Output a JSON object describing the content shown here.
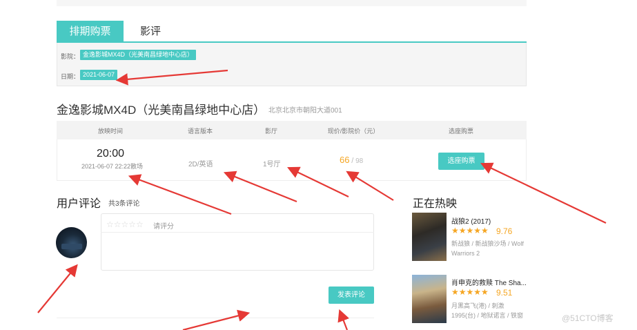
{
  "tabs": {
    "schedule": "排期购票",
    "reviews": "影评"
  },
  "filters": {
    "cinema_label": "影院：",
    "cinema_value": "金逸影城MX4D（光美南昌绿地中心店）",
    "date_label": "日期：",
    "date_value": "2021-06-07"
  },
  "cinema": {
    "name": "金逸影城MX4D（光美南昌绿地中心店）",
    "address": "北京北京市朝阳大道001"
  },
  "table": {
    "headers": [
      "放映时间",
      "语言版本",
      "影厅",
      "现价/影院价（元）",
      "选座购票"
    ],
    "rows": [
      {
        "start": "20:00",
        "end": "2021-06-07 22:22散场",
        "version": "2D/英语",
        "hall": "1号厅",
        "price": "66",
        "slash": "/",
        "original_price": "98",
        "button": "选座购票"
      }
    ]
  },
  "comments": {
    "title": "用户评论",
    "count": "共3条评论",
    "stars": "☆☆☆☆☆",
    "rate_hint": "请评分",
    "publish_button": "发表评论"
  },
  "hot": {
    "title": "正在热映",
    "movies": [
      {
        "title": "战狼2 (2017)",
        "stars": "★★★★★",
        "score": "9.76",
        "meta": "新战狼 / 新战狼沙场 / Wolf Warriors 2"
      },
      {
        "title": "肖申克的救赎 The Sha...",
        "stars": "★★★★★",
        "score": "9.51",
        "meta": "月黑高飞(港) / 刺激 1995(台) / 地狱诺言 / 铁窗"
      }
    ]
  },
  "watermark": "@51CTO博客",
  "colors": {
    "accent": "#48c9c3",
    "price": "#f5a623",
    "annotation_arrow": "#e53935"
  }
}
